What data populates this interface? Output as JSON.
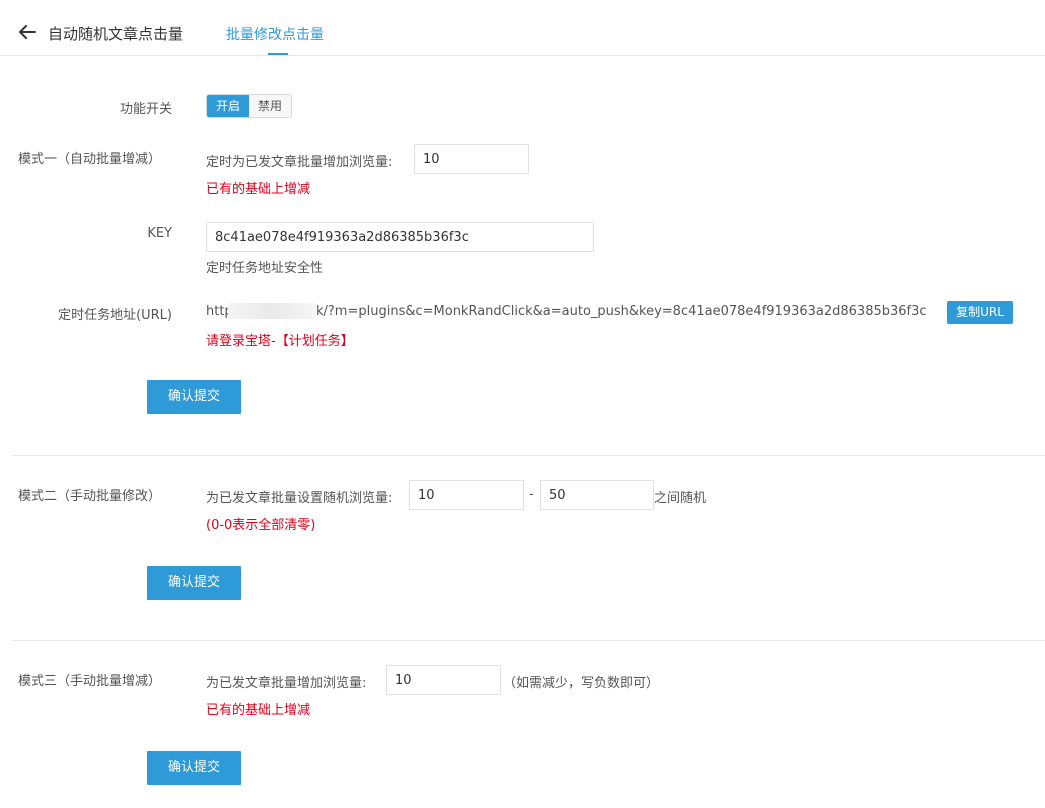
{
  "header": {
    "title": "自动随机文章点击量",
    "tab": "批量修改点击量"
  },
  "feature_switch": {
    "label": "功能开关",
    "on": "开启",
    "off": "禁用"
  },
  "mode1": {
    "label": "模式一（自动批量增减）",
    "field_label": "定时为已发文章批量增加浏览量:",
    "value": "10",
    "hint": "已有的基础上增减",
    "key_label": "KEY",
    "key_value": "8c41ae078e4f919363a2d86385b36f3c",
    "key_hint": "定时任务地址安全性",
    "url_label": "定时任务地址(URL)",
    "url_prefix": "http",
    "url_suffix": "k/?m=plugins&c=MonkRandClick&a=auto_push&key=8c41ae078e4f919363a2d86385b36f3c",
    "copy_button": "复制URL",
    "url_hint": "请登录宝塔-【计划任务】",
    "submit": "确认提交"
  },
  "mode2": {
    "label": "模式二（手动批量修改）",
    "field_label": "为已发文章批量设置随机浏览量:",
    "min_value": "10",
    "separator": "-",
    "max_value": "50",
    "suffix": "之间随机",
    "hint": "(0-0表示全部清零)",
    "submit": "确认提交"
  },
  "mode3": {
    "label": "模式三（手动批量增减）",
    "field_label": "为已发文章批量增加浏览量:",
    "value": "10",
    "suffix": "（如需减少，写负数即可）",
    "hint": "已有的基础上增减",
    "submit": "确认提交"
  }
}
